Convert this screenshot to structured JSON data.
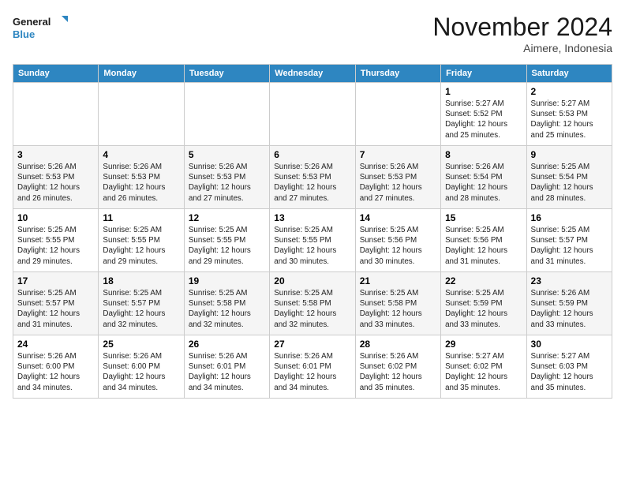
{
  "header": {
    "logo_line1": "General",
    "logo_line2": "Blue",
    "month": "November 2024",
    "location": "Aimere, Indonesia"
  },
  "days_of_week": [
    "Sunday",
    "Monday",
    "Tuesday",
    "Wednesday",
    "Thursday",
    "Friday",
    "Saturday"
  ],
  "weeks": [
    [
      {
        "day": "",
        "info": ""
      },
      {
        "day": "",
        "info": ""
      },
      {
        "day": "",
        "info": ""
      },
      {
        "day": "",
        "info": ""
      },
      {
        "day": "",
        "info": ""
      },
      {
        "day": "1",
        "info": "Sunrise: 5:27 AM\nSunset: 5:52 PM\nDaylight: 12 hours\nand 25 minutes."
      },
      {
        "day": "2",
        "info": "Sunrise: 5:27 AM\nSunset: 5:53 PM\nDaylight: 12 hours\nand 25 minutes."
      }
    ],
    [
      {
        "day": "3",
        "info": "Sunrise: 5:26 AM\nSunset: 5:53 PM\nDaylight: 12 hours\nand 26 minutes."
      },
      {
        "day": "4",
        "info": "Sunrise: 5:26 AM\nSunset: 5:53 PM\nDaylight: 12 hours\nand 26 minutes."
      },
      {
        "day": "5",
        "info": "Sunrise: 5:26 AM\nSunset: 5:53 PM\nDaylight: 12 hours\nand 27 minutes."
      },
      {
        "day": "6",
        "info": "Sunrise: 5:26 AM\nSunset: 5:53 PM\nDaylight: 12 hours\nand 27 minutes."
      },
      {
        "day": "7",
        "info": "Sunrise: 5:26 AM\nSunset: 5:53 PM\nDaylight: 12 hours\nand 27 minutes."
      },
      {
        "day": "8",
        "info": "Sunrise: 5:26 AM\nSunset: 5:54 PM\nDaylight: 12 hours\nand 28 minutes."
      },
      {
        "day": "9",
        "info": "Sunrise: 5:25 AM\nSunset: 5:54 PM\nDaylight: 12 hours\nand 28 minutes."
      }
    ],
    [
      {
        "day": "10",
        "info": "Sunrise: 5:25 AM\nSunset: 5:55 PM\nDaylight: 12 hours\nand 29 minutes."
      },
      {
        "day": "11",
        "info": "Sunrise: 5:25 AM\nSunset: 5:55 PM\nDaylight: 12 hours\nand 29 minutes."
      },
      {
        "day": "12",
        "info": "Sunrise: 5:25 AM\nSunset: 5:55 PM\nDaylight: 12 hours\nand 29 minutes."
      },
      {
        "day": "13",
        "info": "Sunrise: 5:25 AM\nSunset: 5:55 PM\nDaylight: 12 hours\nand 30 minutes."
      },
      {
        "day": "14",
        "info": "Sunrise: 5:25 AM\nSunset: 5:56 PM\nDaylight: 12 hours\nand 30 minutes."
      },
      {
        "day": "15",
        "info": "Sunrise: 5:25 AM\nSunset: 5:56 PM\nDaylight: 12 hours\nand 31 minutes."
      },
      {
        "day": "16",
        "info": "Sunrise: 5:25 AM\nSunset: 5:57 PM\nDaylight: 12 hours\nand 31 minutes."
      }
    ],
    [
      {
        "day": "17",
        "info": "Sunrise: 5:25 AM\nSunset: 5:57 PM\nDaylight: 12 hours\nand 31 minutes."
      },
      {
        "day": "18",
        "info": "Sunrise: 5:25 AM\nSunset: 5:57 PM\nDaylight: 12 hours\nand 32 minutes."
      },
      {
        "day": "19",
        "info": "Sunrise: 5:25 AM\nSunset: 5:58 PM\nDaylight: 12 hours\nand 32 minutes."
      },
      {
        "day": "20",
        "info": "Sunrise: 5:25 AM\nSunset: 5:58 PM\nDaylight: 12 hours\nand 32 minutes."
      },
      {
        "day": "21",
        "info": "Sunrise: 5:25 AM\nSunset: 5:58 PM\nDaylight: 12 hours\nand 33 minutes."
      },
      {
        "day": "22",
        "info": "Sunrise: 5:25 AM\nSunset: 5:59 PM\nDaylight: 12 hours\nand 33 minutes."
      },
      {
        "day": "23",
        "info": "Sunrise: 5:26 AM\nSunset: 5:59 PM\nDaylight: 12 hours\nand 33 minutes."
      }
    ],
    [
      {
        "day": "24",
        "info": "Sunrise: 5:26 AM\nSunset: 6:00 PM\nDaylight: 12 hours\nand 34 minutes."
      },
      {
        "day": "25",
        "info": "Sunrise: 5:26 AM\nSunset: 6:00 PM\nDaylight: 12 hours\nand 34 minutes."
      },
      {
        "day": "26",
        "info": "Sunrise: 5:26 AM\nSunset: 6:01 PM\nDaylight: 12 hours\nand 34 minutes."
      },
      {
        "day": "27",
        "info": "Sunrise: 5:26 AM\nSunset: 6:01 PM\nDaylight: 12 hours\nand 34 minutes."
      },
      {
        "day": "28",
        "info": "Sunrise: 5:26 AM\nSunset: 6:02 PM\nDaylight: 12 hours\nand 35 minutes."
      },
      {
        "day": "29",
        "info": "Sunrise: 5:27 AM\nSunset: 6:02 PM\nDaylight: 12 hours\nand 35 minutes."
      },
      {
        "day": "30",
        "info": "Sunrise: 5:27 AM\nSunset: 6:03 PM\nDaylight: 12 hours\nand 35 minutes."
      }
    ]
  ]
}
